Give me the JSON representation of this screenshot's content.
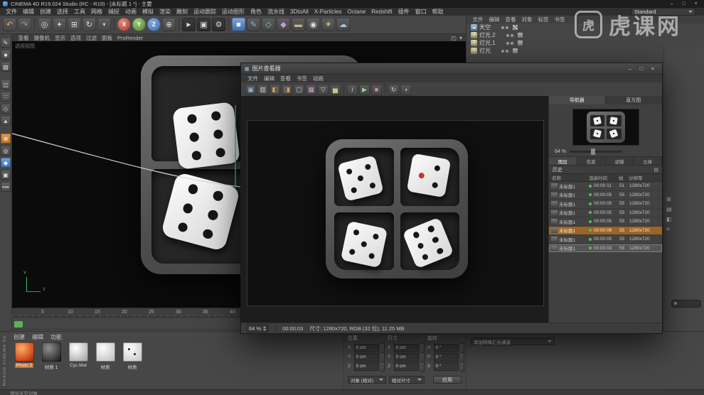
{
  "window": {
    "title": "CINEMA 4D R19.024 Studio (RC - R19) - [未标题 1 *] - 主要",
    "controls": {
      "minimize": "–",
      "maximize": "□",
      "close": "×"
    }
  },
  "menubar": [
    "文件",
    "编辑",
    "创建",
    "选择",
    "工具",
    "网格",
    "捕捉",
    "动画",
    "模拟",
    "渲染",
    "雕刻",
    "运动跟踪",
    "运动图形",
    "角色",
    "流水线",
    "3DtoAll",
    "X-Particles",
    "Octane",
    "Redshift",
    "插件",
    "窗口",
    "帮助"
  ],
  "layout_selector": "Standard",
  "toolbar": {
    "icons": [
      {
        "name": "undo-icon",
        "glyph": "↶"
      },
      {
        "name": "redo-icon",
        "glyph": "↷"
      },
      {
        "name": "live-selection-icon",
        "glyph": "◎"
      },
      {
        "name": "move-icon",
        "glyph": "+"
      },
      {
        "name": "scale-icon",
        "glyph": "⊞"
      },
      {
        "name": "rotate-icon",
        "glyph": "↻"
      },
      {
        "name": "recent-tool-icon",
        "glyph": "▾"
      },
      {
        "name": "lock-x-icon",
        "glyph": "X"
      },
      {
        "name": "lock-y-icon",
        "glyph": "Y"
      },
      {
        "name": "lock-z-icon",
        "glyph": "Z"
      },
      {
        "name": "coordinate-system-icon",
        "glyph": "⊕"
      },
      {
        "name": "render-view-icon",
        "glyph": "▶"
      },
      {
        "name": "render-picture-viewer-icon",
        "glyph": "▣"
      },
      {
        "name": "render-settings-icon",
        "glyph": "⚙"
      },
      {
        "name": "add-cube-icon",
        "glyph": "■"
      },
      {
        "name": "draw-spline-icon",
        "glyph": "✎"
      },
      {
        "name": "add-generator-icon",
        "glyph": "◇"
      },
      {
        "name": "add-deformer-icon",
        "glyph": "◆"
      },
      {
        "name": "add-floor-icon",
        "glyph": "▬"
      },
      {
        "name": "add-camera-icon",
        "glyph": "◉"
      },
      {
        "name": "add-light-icon",
        "glyph": "☀"
      },
      {
        "name": "add-sky-icon",
        "glyph": "☁"
      }
    ]
  },
  "left_toolbar": {
    "icons": [
      {
        "name": "convert-object-icon",
        "glyph": "✎"
      },
      {
        "name": "model-mode-icon",
        "glyph": "■"
      },
      {
        "name": "texture-mode-icon",
        "glyph": "▨"
      },
      {
        "name": "workplane-mode-icon",
        "glyph": "◫"
      },
      {
        "name": "points-mode-icon",
        "glyph": "∷"
      },
      {
        "name": "edges-mode-icon",
        "glyph": "◇"
      },
      {
        "name": "polygons-mode-icon",
        "glyph": "▲"
      },
      {
        "name": "enable-axis-icon",
        "glyph": "⊕"
      },
      {
        "name": "solo-mode-icon",
        "glyph": "◎"
      },
      {
        "name": "snap-icon",
        "glyph": "◆"
      },
      {
        "name": "lock-workplane-icon",
        "glyph": "▣"
      },
      {
        "name": "psr-icon",
        "glyph": "PSR"
      }
    ]
  },
  "viewport": {
    "label": "透视视图",
    "menu": [
      "查看",
      "摄像机",
      "显示",
      "选项",
      "过滤",
      "面板",
      "ProRender"
    ],
    "view_icons": [
      {
        "name": "viewport-layout-icon",
        "glyph": "◰"
      },
      {
        "name": "viewport-menu-icon",
        "glyph": "▾"
      }
    ],
    "ruler": [
      "5",
      "10",
      "15",
      "20",
      "25",
      "30",
      "35",
      "40"
    ],
    "axis_x": "X",
    "axis_y": "Y"
  },
  "object_manager": {
    "menu": [
      "文件",
      "编辑",
      "查看",
      "对象",
      "标签",
      "书签"
    ],
    "items": [
      {
        "name": "天空",
        "icon": "sky-object-icon",
        "glyph": "☁"
      },
      {
        "name": "灯光.2",
        "icon": "light-object-icon",
        "glyph": "☀"
      },
      {
        "name": "灯光.1",
        "icon": "light-object-icon",
        "glyph": "☀"
      },
      {
        "name": "灯光",
        "icon": "light-object-icon",
        "glyph": "☀"
      }
    ],
    "side_icons": [
      {
        "name": "panel-grid-icon",
        "glyph": "⊞"
      },
      {
        "name": "panel-list-icon",
        "glyph": "▤"
      },
      {
        "name": "panel-split-icon",
        "glyph": "◧"
      },
      {
        "name": "panel-menu-icon",
        "glyph": "≡"
      }
    ]
  },
  "picture_viewer": {
    "title": "图片查看器",
    "controls": {
      "minimize": "–",
      "maximize": "□",
      "close": "×"
    },
    "menu": [
      "文件",
      "编辑",
      "查看",
      "书签",
      "动画"
    ],
    "icons": [
      {
        "name": "save-icon",
        "glyph": "▣"
      },
      {
        "name": "copy-icon",
        "glyph": "▥"
      },
      {
        "name": "compare-ab-icon",
        "glyph": "◧"
      },
      {
        "name": "compare-swap-icon",
        "glyph": "◨"
      },
      {
        "name": "zoom-fit-icon",
        "glyph": "▢"
      },
      {
        "name": "channels-icon",
        "glyph": "▦"
      },
      {
        "name": "filter-icon",
        "glyph": "▽"
      },
      {
        "name": "histogram-icon",
        "glyph": "▅"
      },
      {
        "name": "info-icon",
        "glyph": "i"
      },
      {
        "name": "play-icon",
        "glyph": "▶"
      },
      {
        "name": "stop-icon",
        "glyph": "■"
      },
      {
        "name": "loop-icon",
        "glyph": "↻"
      },
      {
        "name": "stereo-icon",
        "glyph": "◑"
      }
    ],
    "tabs": [
      "导航器",
      "直方图"
    ],
    "zoom": "64 %",
    "sub_tabs": [
      "图层",
      "信息",
      "滤镜",
      "立体"
    ],
    "history_title": "历史",
    "history_menu_icon": {
      "name": "history-menu-icon",
      "glyph": "▤"
    },
    "columns": [
      "名称",
      "渲染时间",
      "帧",
      "分辨率"
    ],
    "rows": [
      {
        "name": "未标题1",
        "time": "00:00:11",
        "frame": "51",
        "res": "1280x720"
      },
      {
        "name": "未标题1",
        "time": "00:00:05",
        "frame": "55",
        "res": "1280x720"
      },
      {
        "name": "未标题1",
        "time": "00:00:05",
        "frame": "55",
        "res": "1280x720"
      },
      {
        "name": "未标题1",
        "time": "00:00:05",
        "frame": "55",
        "res": "1280x720"
      },
      {
        "name": "未标题1",
        "time": "00:00:05",
        "frame": "55",
        "res": "1280x720"
      },
      {
        "name": "未标题1",
        "time": "00:00:06",
        "frame": "55",
        "res": "1280x720"
      },
      {
        "name": "未标题1",
        "time": "00:00:05",
        "frame": "55",
        "res": "1280x720"
      },
      {
        "name": "未标题1",
        "time": "00:00:03",
        "frame": "55",
        "res": "1280x720"
      }
    ],
    "status_zoom": "64 %",
    "status_time": "00:00:03",
    "status_info": "尺寸: 1280x720, RGB (32 位), 11.25 MB"
  },
  "materials": {
    "tabs": [
      "创建",
      "编辑",
      "功能"
    ],
    "items": [
      {
        "label": "Photo 5",
        "selected": true
      },
      {
        "label": "材质 1"
      },
      {
        "label": "Cyc.Mat"
      },
      {
        "label": "材质"
      },
      {
        "label": "材质"
      }
    ]
  },
  "coordinates": {
    "groups": [
      {
        "title": "位置",
        "rows": [
          {
            "label": "X",
            "value": "0 cm"
          },
          {
            "label": "Y",
            "value": "0 cm"
          },
          {
            "label": "Z",
            "value": "0 cm"
          }
        ]
      },
      {
        "title": "尺寸",
        "rows": [
          {
            "label": "X",
            "value": "0 cm"
          },
          {
            "label": "Y",
            "value": "0 cm"
          },
          {
            "label": "Z",
            "value": "0 cm"
          }
        ]
      },
      {
        "title": "旋转",
        "rows": [
          {
            "label": "H",
            "value": "0 °"
          },
          {
            "label": "P",
            "value": "0 °"
          },
          {
            "label": "B",
            "value": "0 °"
          }
        ]
      }
    ],
    "mode": "对象 (相对)",
    "size_mode": "相对尺寸",
    "apply": "应用"
  },
  "attribute_panel": {
    "channel_button": "添加特殊汇合通道"
  },
  "status_bar": "增加天空对象",
  "watermark": {
    "logo": "虎",
    "text": "虎课网"
  },
  "branding": "MAXON CINEMA 4D",
  "colors": {
    "accent": "#e8923c",
    "selected_row": "#9a6526",
    "status_green": "#4fc24f",
    "red_pip": "#c03a2b"
  }
}
